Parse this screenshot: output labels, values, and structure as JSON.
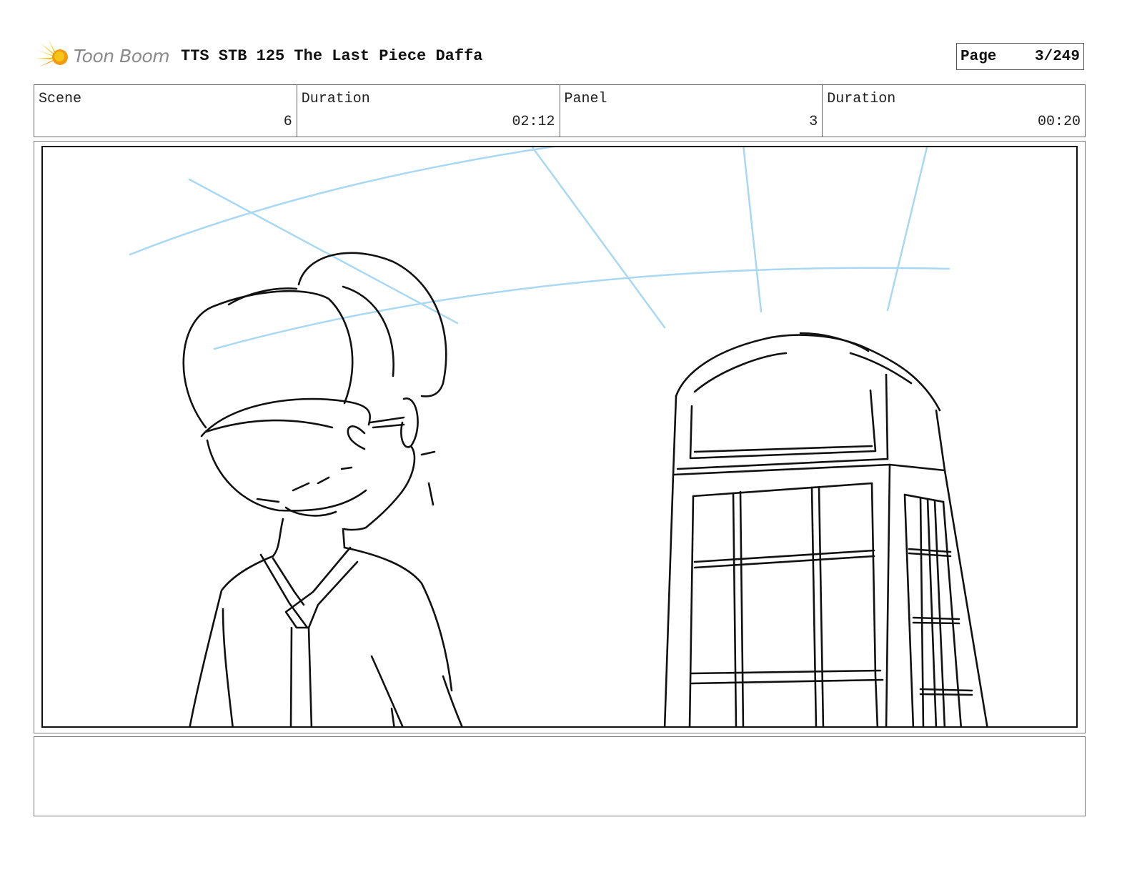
{
  "header": {
    "logo_text": "Toon Boom",
    "title": "TTS STB 125 The Last Piece Daffa",
    "page_label": "Page",
    "page_value": "3/249"
  },
  "info": {
    "scene": {
      "label": "Scene",
      "value": "6"
    },
    "scene_duration": {
      "label": "Duration",
      "value": "02:12"
    },
    "panel": {
      "label": "Panel",
      "value": "3"
    },
    "panel_duration": {
      "label": "Duration",
      "value": "00:20"
    }
  },
  "notes": {
    "text": ""
  },
  "colors": {
    "logo_yellow": "#f5c518",
    "logo_orange": "#f29b11",
    "guide_blue": "#a9d8f2",
    "ink": "#111111"
  }
}
